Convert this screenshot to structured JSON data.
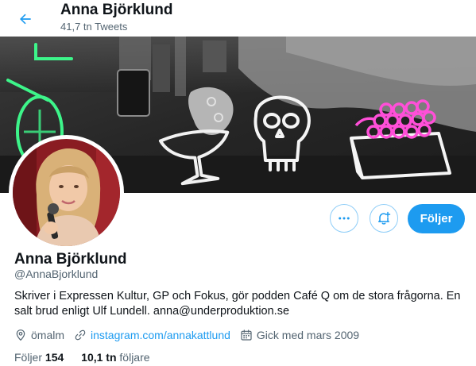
{
  "header": {
    "name": "Anna Björklund",
    "tweet_count": "41,7 tn Tweets"
  },
  "profile": {
    "name": "Anna Björklund",
    "handle": "@AnnaBjorklund",
    "bio": "Skriver i Expressen Kultur, GP och Fokus, gör podden Café Q om de stora frågorna. En salt brud enligt Ulf Lundell. anna@underproduktion.se",
    "location": "ömalm",
    "website": "instagram.com/annakattlund",
    "joined": "Gick med mars 2009",
    "following_label": "Följer",
    "following_count": "154",
    "followers_count": "10,1 tn",
    "followers_label": "följare"
  },
  "actions": {
    "follow_label": "Följer"
  },
  "icons": {
    "back": "arrow-left-icon",
    "more": "more-dots-icon",
    "notify": "bell-plus-icon",
    "location": "location-pin-icon",
    "link": "link-icon",
    "calendar": "calendar-icon"
  },
  "colors": {
    "accent": "#1d9bf0",
    "text": "#0f1419",
    "muted": "#536471",
    "neon_green": "#3df58a",
    "neon_pink": "#ff4fd8"
  }
}
